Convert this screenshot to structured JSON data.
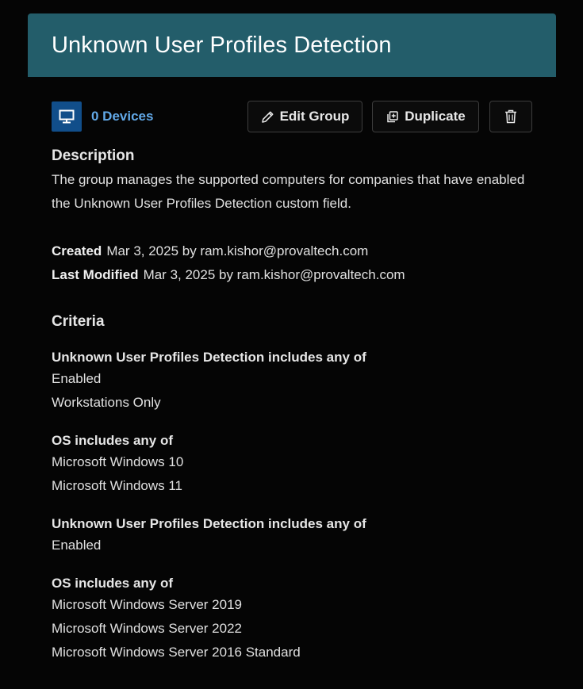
{
  "header": {
    "title": "Unknown User Profiles Detection"
  },
  "toolbar": {
    "devices_label": "0 Devices",
    "edit_label": "Edit Group",
    "duplicate_label": "Duplicate",
    "device_icon": "monitor-icon",
    "edit_icon": "pencil-icon",
    "duplicate_icon": "duplicate-icon",
    "delete_icon": "trash-icon"
  },
  "description": {
    "heading": "Description",
    "text": "The group manages the supported computers for companies that have enabled the Unknown User Profiles Detection custom field."
  },
  "meta": {
    "created_label": "Created",
    "created_value": "Mar 3, 2025 by ram.kishor@provaltech.com",
    "modified_label": "Last Modified",
    "modified_value": "Mar 3, 2025 by ram.kishor@provaltech.com"
  },
  "criteria": {
    "heading": "Criteria",
    "groups": [
      {
        "title": "Unknown User Profiles Detection includes any of",
        "values": [
          "Enabled",
          "Workstations Only"
        ]
      },
      {
        "title": "OS includes any of",
        "values": [
          "Microsoft Windows 10",
          "Microsoft Windows 11"
        ]
      },
      {
        "title": "Unknown User Profiles Detection includes any of",
        "values": [
          "Enabled"
        ]
      },
      {
        "title": "OS includes any of",
        "values": [
          "Microsoft Windows Server 2019",
          "Microsoft Windows Server 2022",
          "Microsoft Windows Server 2016 Standard"
        ]
      }
    ]
  },
  "colors": {
    "header_bg": "#235d6a",
    "page_bg": "#050505",
    "link": "#62a9e8",
    "device_icon_bg": "#114e8a"
  }
}
